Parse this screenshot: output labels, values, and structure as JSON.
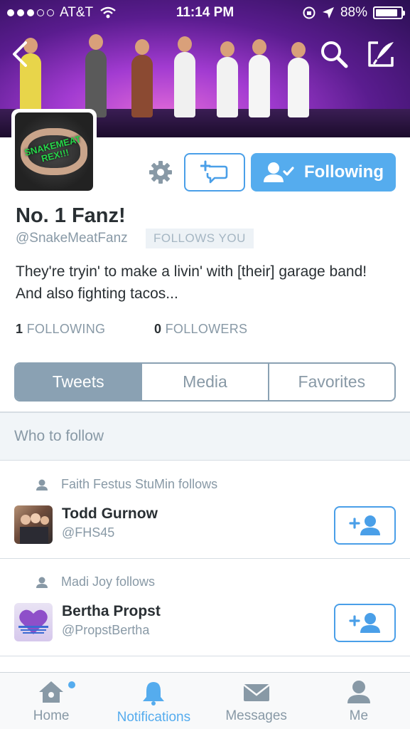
{
  "status_bar": {
    "carrier": "AT&T",
    "time": "11:14 PM",
    "battery": "88%",
    "battery_level": 0.88
  },
  "header": {
    "back_icon": "chevron-left-icon",
    "search_icon": "search-icon",
    "compose_icon": "compose-tweet-icon"
  },
  "profile": {
    "avatar_text": "SNAKEMEAT REX!!!",
    "name": "No. 1 Fanz!",
    "handle": "@SnakeMeatFanz",
    "follows_you": "FOLLOWS YOU",
    "bio": "They're tryin' to make a livin' with [their] garage band! And also fighting tacos...",
    "following_count": "1",
    "following_label": "FOLLOWING",
    "followers_count": "0",
    "followers_label": "FOLLOWERS"
  },
  "actions": {
    "following_label": "Following",
    "accent_color": "#55acee"
  },
  "tabs": [
    {
      "label": "Tweets",
      "active": true
    },
    {
      "label": "Media",
      "active": false
    },
    {
      "label": "Favorites",
      "active": false
    }
  ],
  "who_to_follow": {
    "title": "Who to follow",
    "items": [
      {
        "context": "Faith Festus StuMin follows",
        "name": "Todd Gurnow",
        "handle": "@FHS45"
      },
      {
        "context": "Madi Joy follows",
        "name": "Bertha Propst",
        "handle": "@PropstBertha"
      }
    ]
  },
  "tabbar": [
    {
      "label": "Home",
      "icon": "home-icon",
      "active": false
    },
    {
      "label": "Notifications",
      "icon": "bell-icon",
      "active": true
    },
    {
      "label": "Messages",
      "icon": "envelope-icon",
      "active": false
    },
    {
      "label": "Me",
      "icon": "person-icon",
      "active": false
    }
  ]
}
